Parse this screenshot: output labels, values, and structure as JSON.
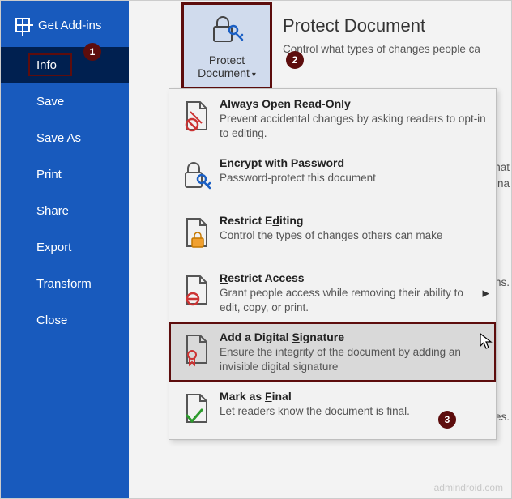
{
  "sidebar": {
    "addins_label": "Get Add-ins",
    "items": [
      {
        "label": "Info"
      },
      {
        "label": "Save"
      },
      {
        "label": "Save As"
      },
      {
        "label": "Print"
      },
      {
        "label": "Share"
      },
      {
        "label": "Export"
      },
      {
        "label": "Transform"
      },
      {
        "label": "Close"
      }
    ]
  },
  "header": {
    "title": "Protect Document",
    "subtitle": "Control what types of changes people ca"
  },
  "background_text": {
    "line1": "are that",
    "line2": "uthor's na",
    "line3": "ns.",
    "line4": "es."
  },
  "protect_button": {
    "line1": "Protect",
    "line2": "Document"
  },
  "menu": {
    "items": [
      {
        "title_pre": "Always ",
        "title_u": "O",
        "title_post": "pen Read-Only",
        "desc": "Prevent accidental changes by asking readers to opt-in to editing."
      },
      {
        "title_pre": "",
        "title_u": "E",
        "title_post": "ncrypt with Password",
        "desc": "Password-protect this document"
      },
      {
        "title_pre": "Restrict E",
        "title_u": "d",
        "title_post": "iting",
        "desc": "Control the types of changes others can make"
      },
      {
        "title_pre": "",
        "title_u": "R",
        "title_post": "estrict Access",
        "desc": "Grant people access while removing their ability to edit, copy, or print.",
        "has_submenu": true
      },
      {
        "title_pre": "Add a Digital ",
        "title_u": "S",
        "title_post": "ignature",
        "desc": "Ensure the integrity of the document by adding an invisible digital signature",
        "highlighted": true
      },
      {
        "title_pre": "Mark as ",
        "title_u": "F",
        "title_post": "inal",
        "desc": "Let readers know the document is final."
      }
    ]
  },
  "badges": {
    "b1": "1",
    "b2": "2",
    "b3": "3"
  },
  "watermark": "admindroid.com"
}
